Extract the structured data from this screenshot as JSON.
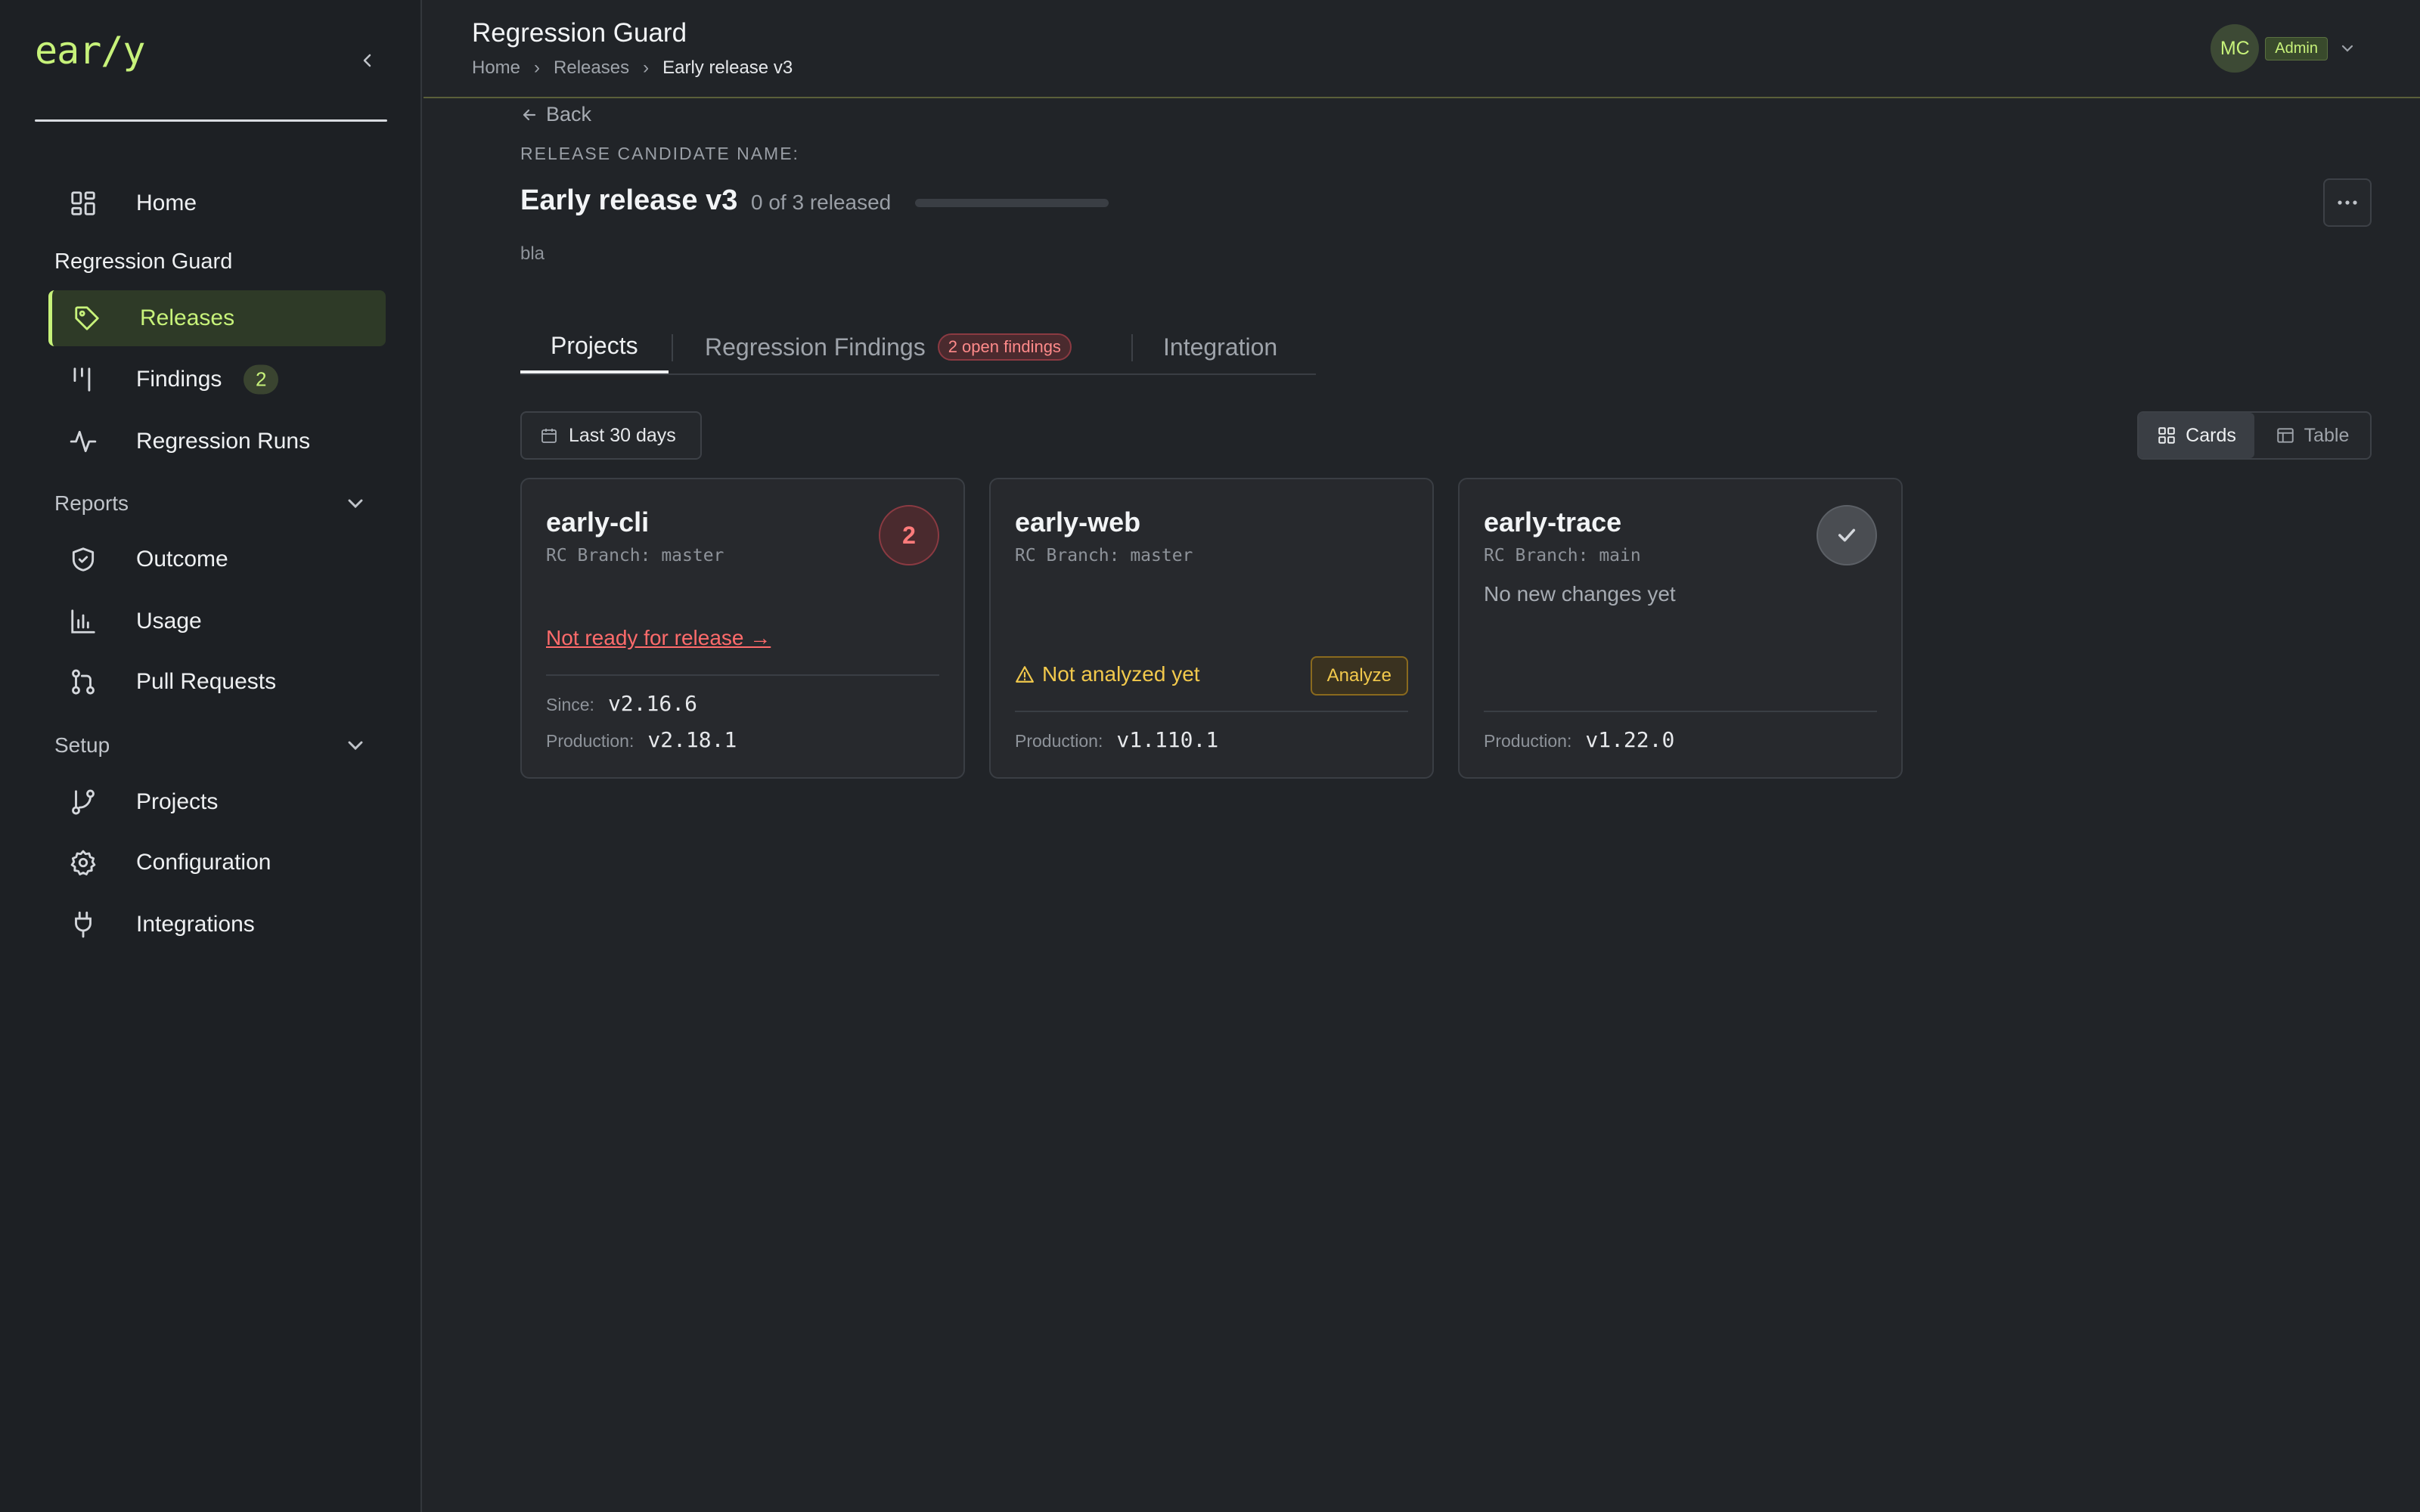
{
  "app": {
    "logo": "ear/y",
    "title": "Regression Guard"
  },
  "breadcrumb": [
    "Home",
    "Releases",
    "Early release v3"
  ],
  "user": {
    "initials": "MC",
    "role": "Admin"
  },
  "sidebar": {
    "home": "Home",
    "regression_guard": "Regression Guard",
    "releases": "Releases",
    "findings": "Findings",
    "findings_count": "2",
    "regression_runs": "Regression Runs",
    "reports": "Reports",
    "outcome": "Outcome",
    "usage": "Usage",
    "pull_requests": "Pull Requests",
    "setup": "Setup",
    "projects": "Projects",
    "configuration": "Configuration",
    "integrations": "Integrations"
  },
  "release": {
    "back": "Back",
    "label": "RELEASE CANDIDATE NAME:",
    "name": "Early release v3",
    "progress_text": "0 of 3 released",
    "released": 0,
    "total": 3,
    "description": "bla"
  },
  "tabs": {
    "projects": "Projects",
    "findings": "Regression Findings",
    "findings_badge": "2 open findings",
    "integration": "Integration"
  },
  "filters": {
    "date_range": "Last 30 days",
    "view_cards": "Cards",
    "view_table": "Table"
  },
  "cards": [
    {
      "name": "early-cli",
      "branch": "RC Branch: master",
      "findings": "2",
      "status": "Not ready for release →",
      "since_label": "Since:",
      "since": "v2.16.6",
      "prod_label": "Production:",
      "prod": "v2.18.1"
    },
    {
      "name": "early-web",
      "branch": "RC Branch: master",
      "status": "Not analyzed yet",
      "action": "Analyze",
      "prod_label": "Production:",
      "prod": "v1.110.1"
    },
    {
      "name": "early-trace",
      "branch": "RC Branch: main",
      "note": "No new changes yet",
      "prod_label": "Production:",
      "prod": "v1.22.0"
    }
  ],
  "colors": {
    "accent": "#c7f27a",
    "danger": "#ff6b6b",
    "warning": "#f2c94c",
    "background": "#212428"
  }
}
